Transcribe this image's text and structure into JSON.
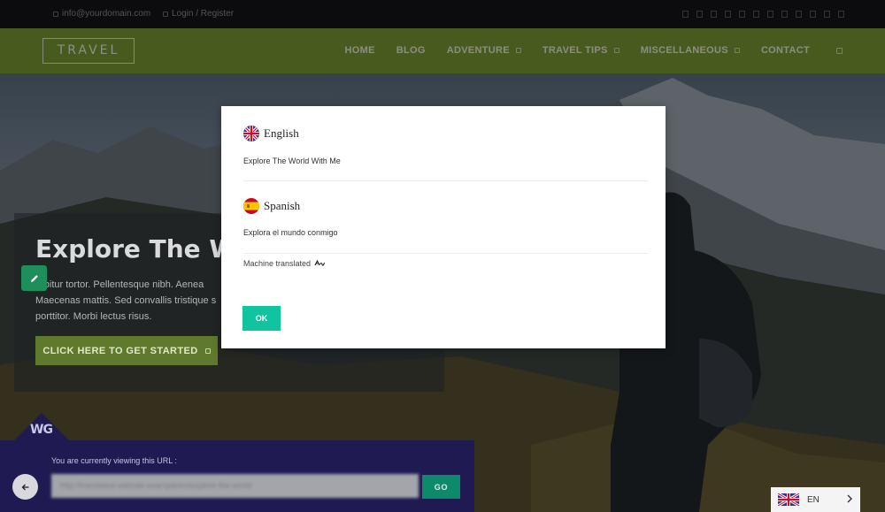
{
  "topbar": {
    "email": "info@yourdomain.com",
    "login": "Login / Register",
    "social_icons": [
      "social-icon",
      "social-icon",
      "social-icon",
      "social-icon",
      "social-icon",
      "social-icon",
      "social-icon",
      "social-icon",
      "social-icon",
      "social-icon",
      "social-icon",
      "social-icon"
    ]
  },
  "header": {
    "logo": "TRAVEL",
    "nav": [
      {
        "label": "HOME",
        "has_dropdown": false
      },
      {
        "label": "BLOG",
        "has_dropdown": false
      },
      {
        "label": "ADVENTURE",
        "has_dropdown": true
      },
      {
        "label": "TRAVEL TIPS",
        "has_dropdown": true
      },
      {
        "label": "MISCELLANEOUS",
        "has_dropdown": true
      },
      {
        "label": "CONTACT",
        "has_dropdown": false
      }
    ]
  },
  "hero": {
    "title": "Explore The Wo",
    "text": "rabitur tortor. Pellentesque nibh. Aenea Maecenas mattis. Sed convallis tristique s porttitor. Morbi lectus risus.",
    "cta_label": "CLICK HERE TO GET STARTED"
  },
  "modal": {
    "languages": [
      {
        "name": "English",
        "flag": "uk-flag-icon",
        "phrase": "Explore The World With Me"
      },
      {
        "name": "Spanish",
        "flag": "spain-flag-icon",
        "phrase": "Explora el mundo conmigo"
      }
    ],
    "machine_translated_label": "Machine translated",
    "ok_label": "OK"
  },
  "weglot": {
    "logo": "WG",
    "viewing_label": "You are currently viewing this URL :",
    "url_value": "http://translated-website.example/es/explore-the-world",
    "go_label": "GO"
  },
  "language_switcher": {
    "code": "EN",
    "flag": "uk-flag-icon"
  },
  "colors": {
    "nav_green": "#7a9e34",
    "ok_teal": "#10c4a0",
    "weglot_navy": "#1f1b52"
  }
}
